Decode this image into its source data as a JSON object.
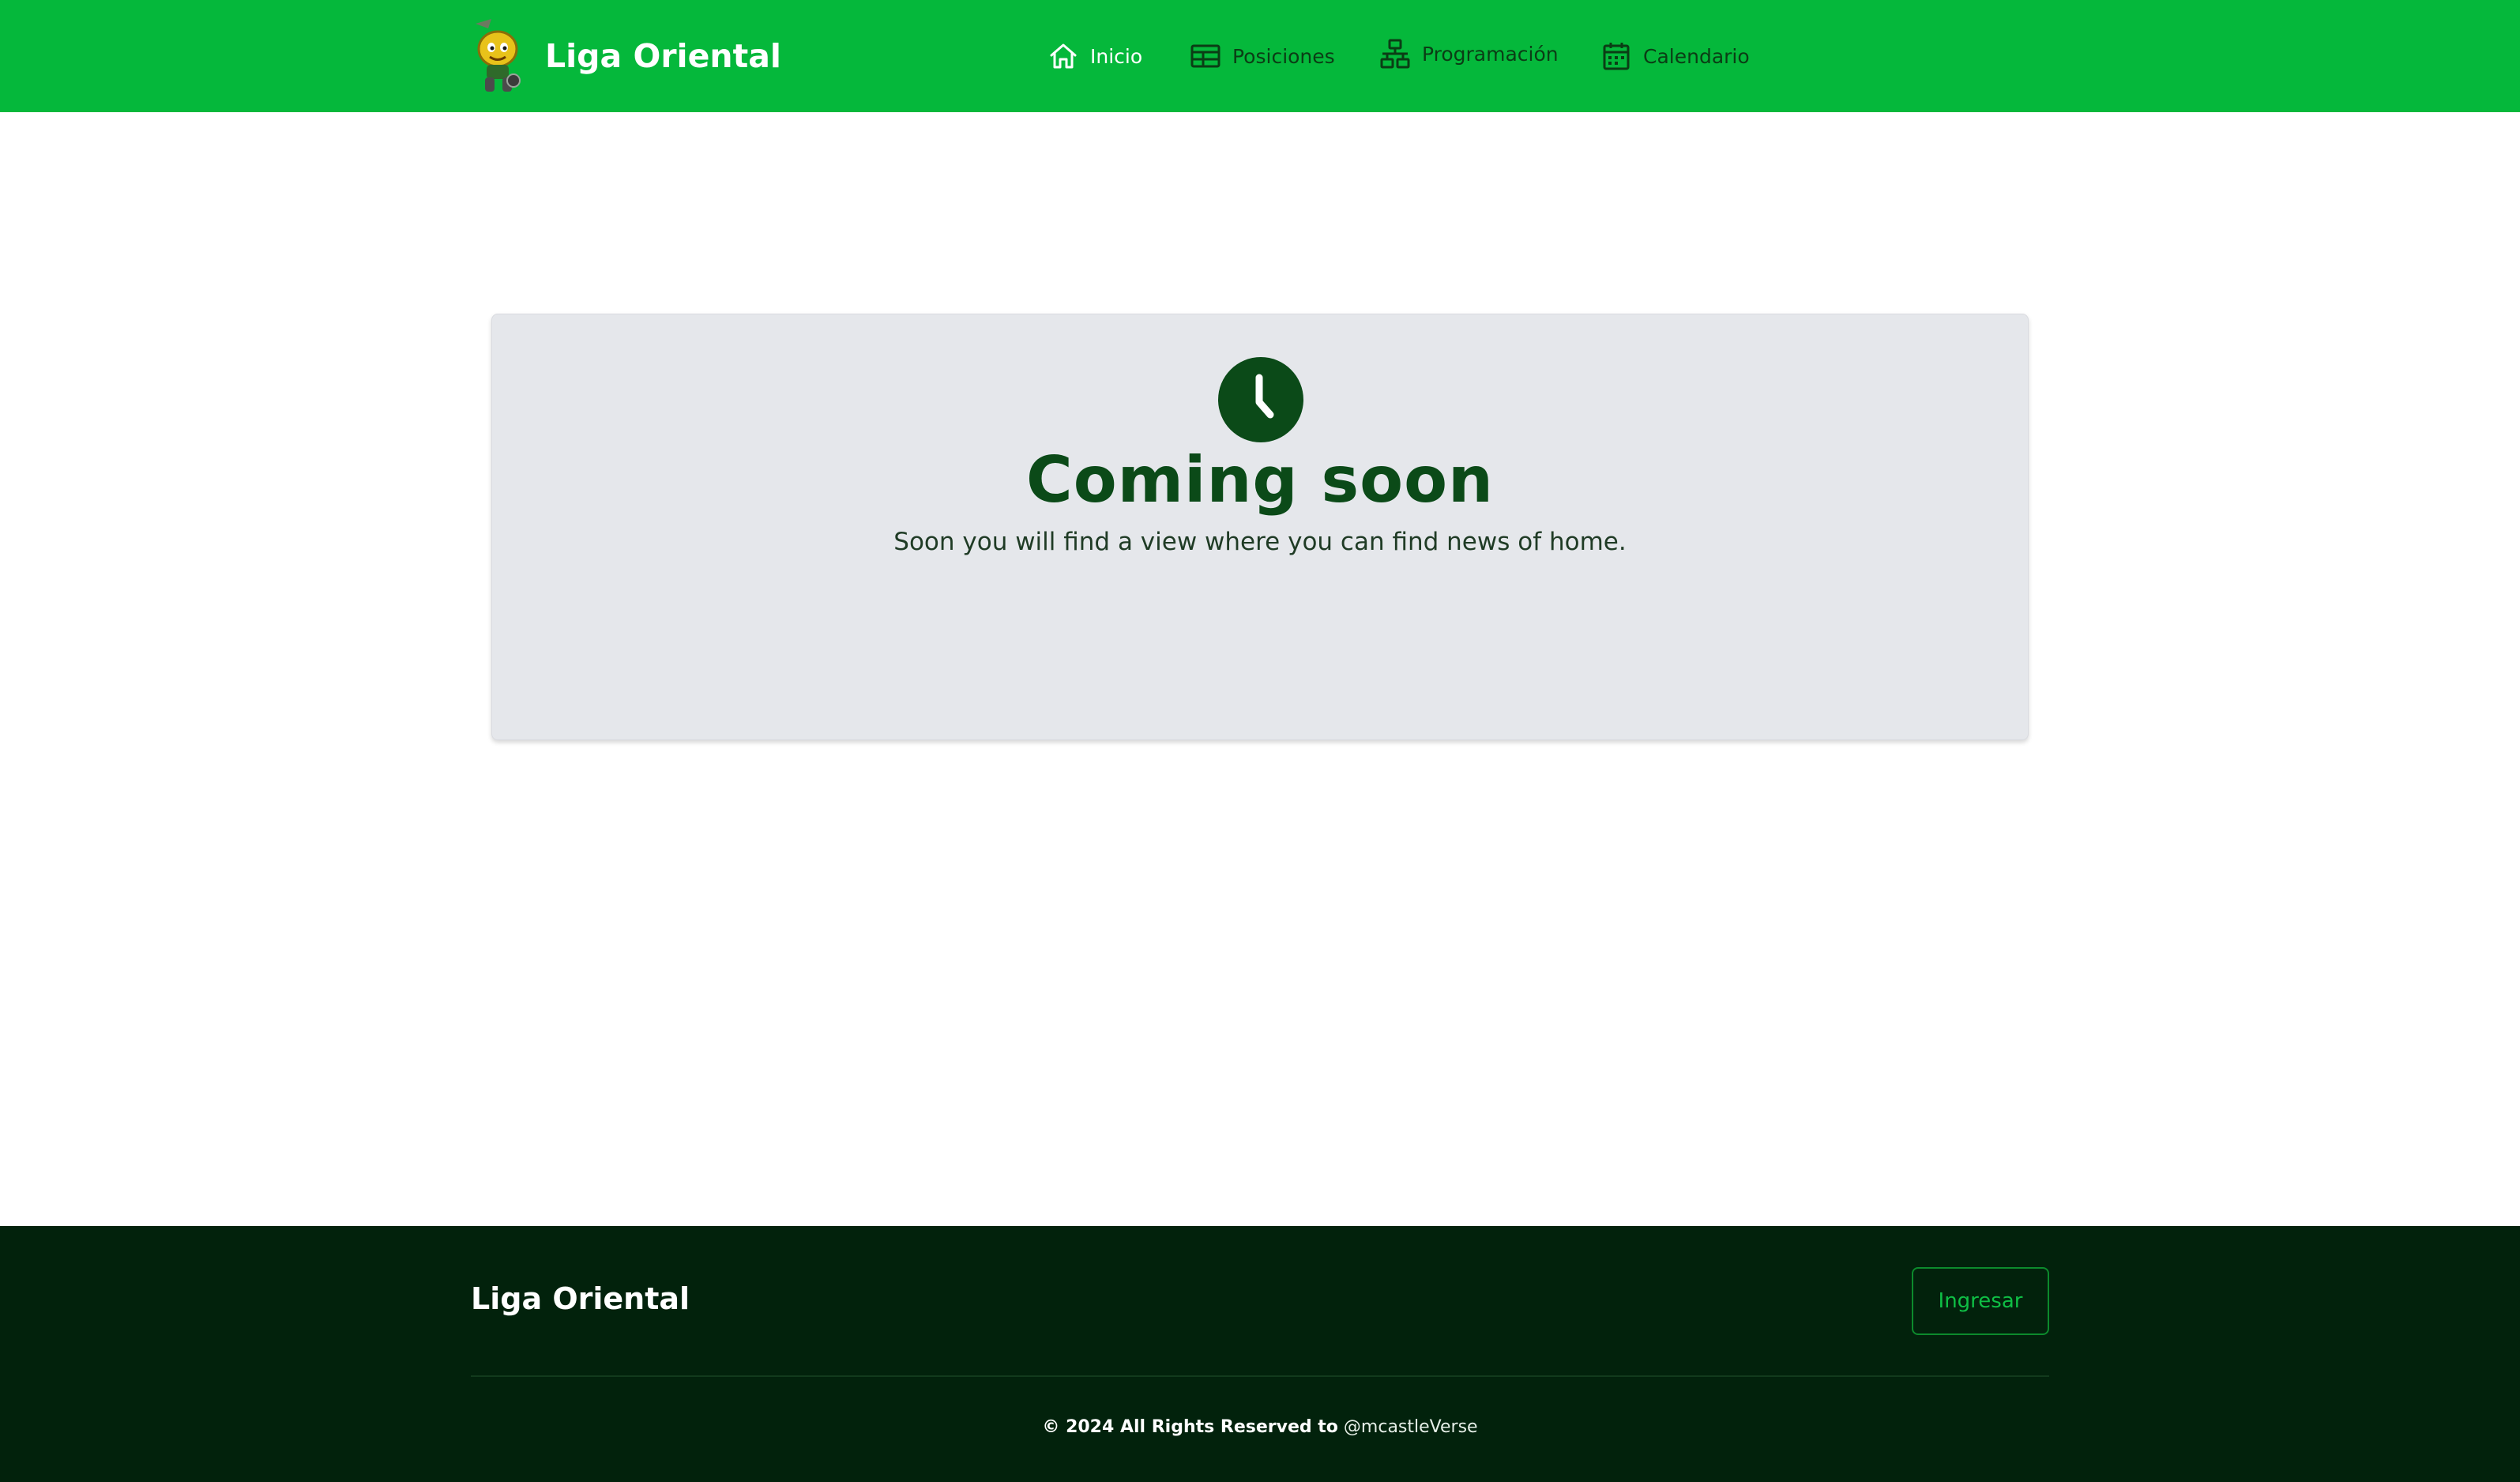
{
  "header": {
    "brand": "Liga Oriental",
    "logo_icon": "mascot-logo"
  },
  "nav": {
    "items": [
      {
        "label": "Inicio",
        "icon": "home-icon",
        "active": true
      },
      {
        "label": "Posiciones",
        "icon": "table-icon",
        "active": false
      },
      {
        "label": "Programación",
        "icon": "sitemap-icon",
        "active": false
      },
      {
        "label": "Calendario",
        "icon": "calendar-icon",
        "active": false
      }
    ]
  },
  "main": {
    "icon": "clock-icon",
    "title": "Coming soon",
    "text": "Soon you will find a view where you can find news of home."
  },
  "footer": {
    "brand": "Liga Oriental",
    "login_label": "Ingresar",
    "copyright": "© 2024 All Rights Reserved to",
    "handle": "@mcastleVerse"
  },
  "colors": {
    "header_bg": "#05b83b",
    "footer_bg": "#02220c",
    "card_bg": "#e5e7eb",
    "accent_dark": "#0b4a18",
    "accent_green": "#0fbf45"
  }
}
